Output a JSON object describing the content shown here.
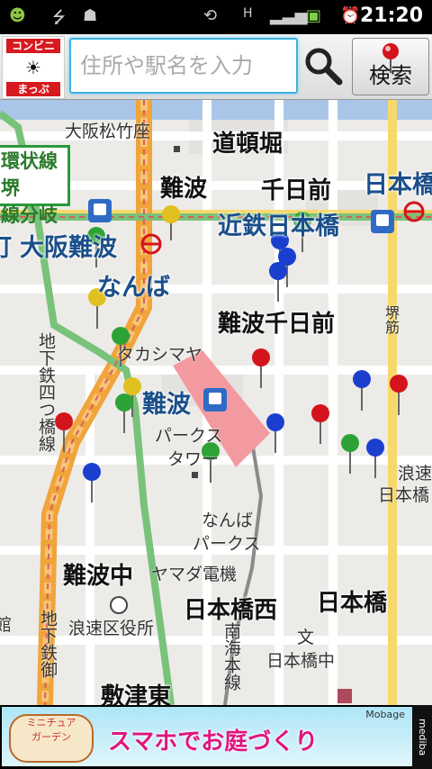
{
  "status": {
    "time": "21:20"
  },
  "logo": {
    "line1": "コンビニ",
    "line2": "まっぷ"
  },
  "search": {
    "placeholder": "住所や駅名を入力",
    "button": "検索"
  },
  "map": {
    "labels": {
      "osaka_matsutake": "大阪松竹座",
      "dotonbori": "道頓堀",
      "kanjo_line": "環状線堺",
      "line_branch": "線分岐",
      "namba_top": "難波",
      "sennichimae": "千日前",
      "nipponbashi_top": "日本橋",
      "kintetsu_nipponbashi": "近鉄日本橋",
      "osaka_namba": "大阪難波",
      "namba_hira": "なんば",
      "namba_sennichimae": "難波千日前",
      "takashimaya": "タカシマヤ",
      "namba_station": "難波",
      "parks_tower_1": "パークス",
      "parks_tower_2": "タワー",
      "namba_parks_1": "なんば",
      "namba_parks_2": "パークス",
      "nambanaka": "難波中",
      "yamada_denki": "ヤマダ電機",
      "nipponbashi_nishi": "日本橋西",
      "nipponbashi_2": "日本橋",
      "naniwa_ward": "浪速区役所",
      "nipponbashi_naka": "日本橋中",
      "shikitsu_higashi": "敷津東",
      "naniwa_right_1": "浪速",
      "naniwa_right_2": "日本橋",
      "subway_yotsubashi": "地下鉄四つ橋線",
      "subway_mido": "地下鉄御",
      "nankai_line": "南海本線",
      "sakaisuji": "堺筋",
      "kan_left": "館",
      "machi_left": "町",
      "bun_symbol": "文"
    }
  },
  "ad": {
    "badge_line1": "ミニチュア",
    "badge_line2": "ガーデン",
    "headline": "スマホでお庭づくり",
    "mobage": "Mobage",
    "brand": "mediba"
  }
}
